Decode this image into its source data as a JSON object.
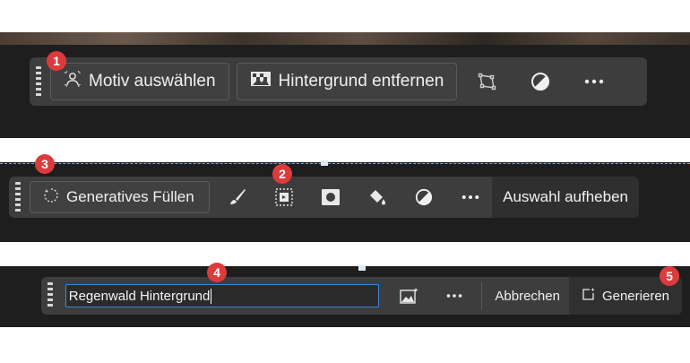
{
  "callouts": [
    "1",
    "2",
    "3",
    "4",
    "5"
  ],
  "toolbar_1": {
    "select_subject_label": "Motiv auswählen",
    "remove_background_label": "Hintergrund entfernen",
    "icons": [
      "transform-icon",
      "adjust-icon",
      "more-icon"
    ]
  },
  "toolbar_2": {
    "generative_fill_label": "Generatives Füllen",
    "icons": [
      "brush-icon",
      "invert-selection-icon",
      "mask-icon",
      "fill-bucket-icon",
      "adjust-icon",
      "more-icon"
    ],
    "deselect_label": "Auswahl aufheben"
  },
  "toolbar_3": {
    "prompt_value": "Regenwald Hintergrund",
    "icons": [
      "reference-image-icon",
      "more-icon"
    ],
    "cancel_label": "Abbrechen",
    "generate_label": "Generieren"
  },
  "colors": {
    "callout": "#dc3b3b",
    "toolbar": "#3d3d3d",
    "canvas": "#1e1e1e",
    "input_focus": "#3f86d6",
    "selection_marquee": "#6fa8dc"
  }
}
